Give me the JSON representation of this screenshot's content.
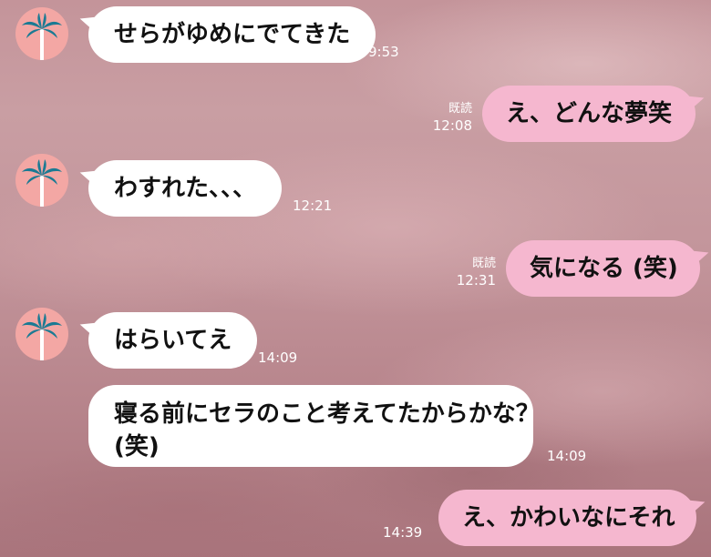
{
  "chat": {
    "read_label": "既読",
    "messages": [
      {
        "dir": "in",
        "text": "せらがゆめにでてきた",
        "time": "9:53"
      },
      {
        "dir": "out",
        "text": "え、どんな夢笑",
        "time": "12:08",
        "read": "既読"
      },
      {
        "dir": "in",
        "text": "わすれた、、、",
        "time": "12:21"
      },
      {
        "dir": "out",
        "text": "気になる (笑)",
        "time": "12:31",
        "read": "既読"
      },
      {
        "dir": "in",
        "text": "はらいてえ",
        "time": "14:09"
      },
      {
        "dir": "in",
        "text_line1": "寝る前にセラのこと考えてたからかな？",
        "text_line2": "(笑)",
        "time": "14:09"
      },
      {
        "dir": "out",
        "text": "え、かわいなにそれ",
        "time": "14:39"
      }
    ]
  },
  "colors": {
    "incoming_bubble": "#ffffff",
    "outgoing_bubble": "#f5b7cf",
    "avatar_bg": "#f3a7a4",
    "palm_leaves": "#1b7a93"
  },
  "icons": {
    "avatar": "palm-tree-icon"
  }
}
